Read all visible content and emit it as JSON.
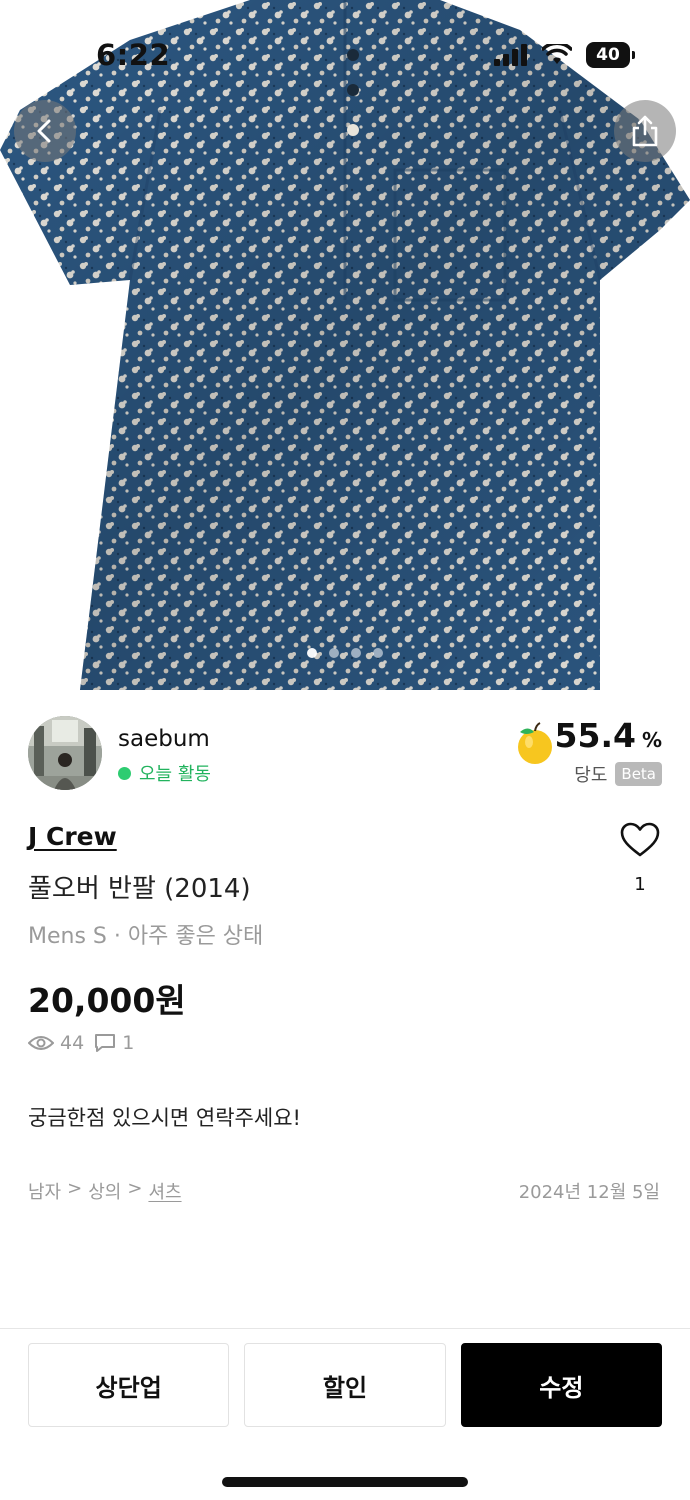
{
  "status_bar": {
    "time": "6:22",
    "battery": "40"
  },
  "seller": {
    "name": "saebum",
    "activity": "오늘 활동",
    "score_value": "55.4",
    "score_unit": "%",
    "score_label": "당도",
    "score_badge": "Beta"
  },
  "product": {
    "brand": "J Crew",
    "title": "풀오버 반팔 (2014)",
    "meta": "Mens S · 아주 좋은 상태",
    "price": "20,000원",
    "likes": "1",
    "views": "44",
    "comments": "1",
    "description": "궁금한점 있으시면 연락주세요!",
    "category": [
      "남자",
      ">",
      "상의",
      ">",
      "셔츠"
    ],
    "date": "2024년 12월 5일"
  },
  "gallery": {
    "page_count": 4,
    "active_index": 0
  },
  "actions": {
    "bump_label": "상단업",
    "discount_label": "할인",
    "edit_label": "수정"
  },
  "colors": {
    "accent_green": "#2ecc71",
    "primary_button": "#000000",
    "shirt_blue": "#2f5d8a"
  },
  "icons": [
    "back-icon",
    "share-icon",
    "heart-icon",
    "eye-icon",
    "comment-icon",
    "apple-icon"
  ]
}
